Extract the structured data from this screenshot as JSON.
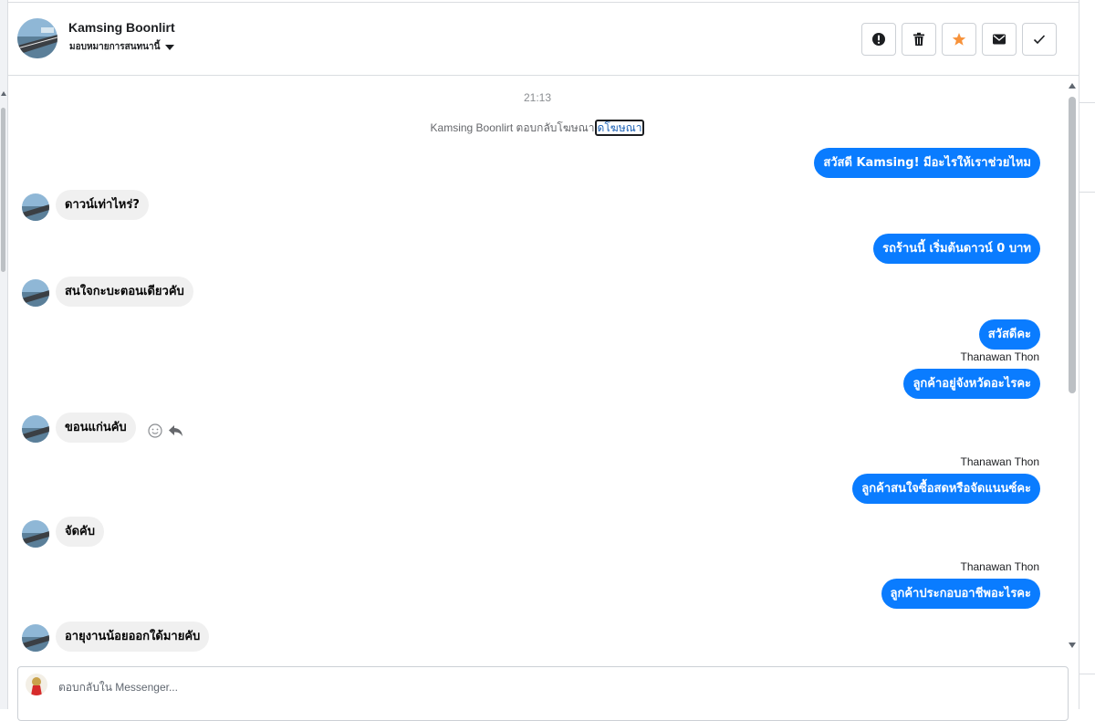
{
  "header": {
    "contact_name": "Kamsing Boonlirt",
    "assign_label": "มอบหมายการสนทนานี้",
    "actions": [
      {
        "name": "report-button",
        "icon": "exclamation-icon"
      },
      {
        "name": "delete-button",
        "icon": "trash-icon"
      },
      {
        "name": "star-button",
        "icon": "star-icon"
      },
      {
        "name": "mark-unread-button",
        "icon": "envelope-icon"
      },
      {
        "name": "mark-done-button",
        "icon": "check-icon"
      }
    ]
  },
  "chat": {
    "timestamp": "21:13",
    "reply_note_prefix": "Kamsing Boonlirt ตอบกลับโฆษณา",
    "reply_note_link": "ดโฆษณา",
    "messages": [
      {
        "dir": "out",
        "text": "สวัสดี Kamsing! มีอะไรให้เราช่วยไหม"
      },
      {
        "dir": "in",
        "text": "ดาวน์เท่าไหร่?"
      },
      {
        "dir": "out",
        "text": "รถร้านนี้ เริ่มต้นดาวน์ 0 บาท"
      },
      {
        "dir": "in",
        "text": "สนใจกะบะตอนเดียวคับ"
      },
      {
        "dir": "out",
        "text": "สวัสดีคะ"
      },
      {
        "dir": "sender",
        "text": "Thanawan Thon"
      },
      {
        "dir": "out",
        "text": "ลูกค้าอยู่จังหวัดอะไรคะ"
      },
      {
        "dir": "in",
        "text": "ขอนแก่นคับ"
      },
      {
        "dir": "sender",
        "text": "Thanawan Thon"
      },
      {
        "dir": "out",
        "text": "ลูกค้าสนใจซื้อสดหรือจัดแนนซ์คะ"
      },
      {
        "dir": "in",
        "text": "จัดคับ"
      },
      {
        "dir": "sender",
        "text": "Thanawan Thon"
      },
      {
        "dir": "out",
        "text": "ลูกค้าประกอบอาชีพอะไรคะ"
      },
      {
        "dir": "in",
        "text": "อายุงานน้อยออกใด้มายคับ"
      }
    ]
  },
  "composer": {
    "placeholder": "ตอบกลับใน Messenger..."
  },
  "colors": {
    "outgoing_bubble": "#0a7cff",
    "incoming_bubble": "#f0f0f0",
    "star_active": "#f7923a"
  }
}
